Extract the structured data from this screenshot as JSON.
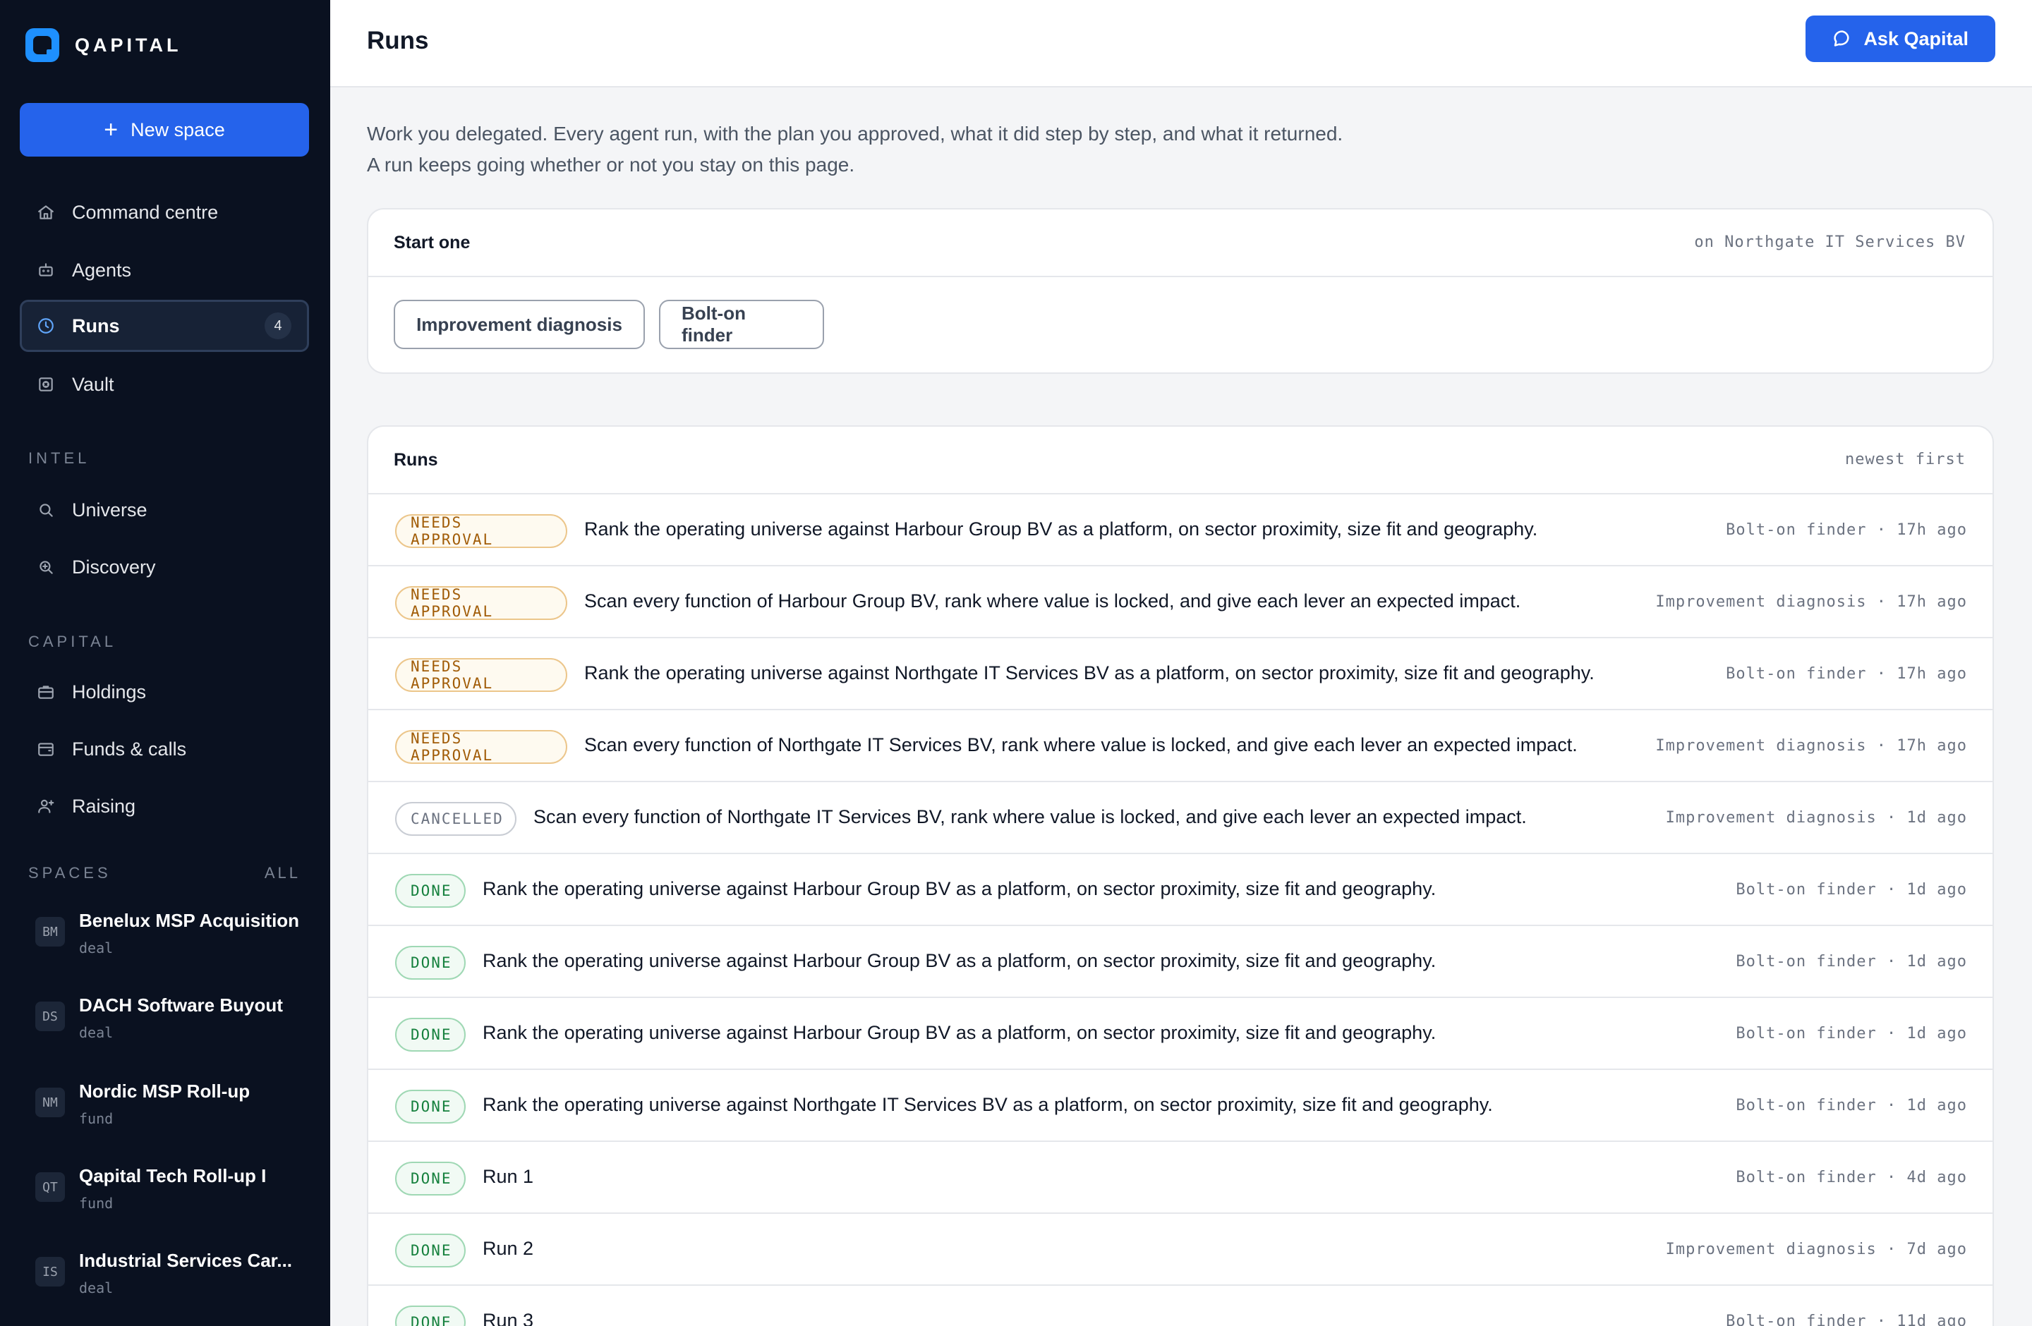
{
  "brand": {
    "name": "QAPITAL"
  },
  "sidebar": {
    "new_space_label": "New space",
    "nav": [
      {
        "label": "Command centre",
        "icon": "home-icon"
      },
      {
        "label": "Agents",
        "icon": "bot-icon"
      },
      {
        "label": "Runs",
        "icon": "clock-icon",
        "badge": "4",
        "active": true
      },
      {
        "label": "Vault",
        "icon": "vault-icon"
      }
    ],
    "intel_label": "INTEL",
    "intel": [
      {
        "label": "Universe",
        "icon": "search-icon"
      },
      {
        "label": "Discovery",
        "icon": "zoom-in-icon"
      }
    ],
    "capital_label": "CAPITAL",
    "capital": [
      {
        "label": "Holdings",
        "icon": "briefcase-icon"
      },
      {
        "label": "Funds & calls",
        "icon": "wallet-icon"
      },
      {
        "label": "Raising",
        "icon": "user-plus-icon"
      }
    ],
    "spaces_label": "SPACES",
    "spaces_all_label": "ALL",
    "spaces": [
      {
        "initials": "BM",
        "name": "Benelux MSP Acquisition",
        "kind": "deal"
      },
      {
        "initials": "DS",
        "name": "DACH Software Buyout",
        "kind": "deal"
      },
      {
        "initials": "NM",
        "name": "Nordic MSP Roll-up",
        "kind": "fund"
      },
      {
        "initials": "QT",
        "name": "Qapital Tech Roll-up I",
        "kind": "fund"
      },
      {
        "initials": "IS",
        "name": "Industrial Services Car...",
        "kind": "deal"
      }
    ]
  },
  "header": {
    "title": "Runs",
    "ask_label": "Ask Qapital"
  },
  "intro": "Work you delegated. Every agent run, with the plan you approved, what it did step by step, and what it returned. A run keeps going whether or not you stay on this page.",
  "start": {
    "title": "Start one",
    "context": "on Northgate IT Services BV",
    "buttons": [
      "Improvement diagnosis",
      "Bolt-on finder"
    ]
  },
  "runs": {
    "title": "Runs",
    "sort": "newest first",
    "items": [
      {
        "status": "NEEDS APPROVAL",
        "kind": "needs",
        "text": "Rank the operating universe against Harbour Group BV as a platform, on sector proximity, size fit and geography.",
        "meta": "Bolt-on finder · 17h ago"
      },
      {
        "status": "NEEDS APPROVAL",
        "kind": "needs",
        "text": "Scan every function of Harbour Group BV, rank where value is locked, and give each lever an expected impact.",
        "meta": "Improvement diagnosis · 17h ago"
      },
      {
        "status": "NEEDS APPROVAL",
        "kind": "needs",
        "text": "Rank the operating universe against Northgate IT Services BV as a platform, on sector proximity, size fit and geography.",
        "meta": "Bolt-on finder · 17h ago"
      },
      {
        "status": "NEEDS APPROVAL",
        "kind": "needs",
        "text": "Scan every function of Northgate IT Services BV, rank where value is locked, and give each lever an expected impact.",
        "meta": "Improvement diagnosis · 17h ago"
      },
      {
        "status": "CANCELLED",
        "kind": "cancelled",
        "text": "Scan every function of Northgate IT Services BV, rank where value is locked, and give each lever an expected impact.",
        "meta": "Improvement diagnosis · 1d ago"
      },
      {
        "status": "DONE",
        "kind": "done",
        "text": "Rank the operating universe against Harbour Group BV as a platform, on sector proximity, size fit and geography.",
        "meta": "Bolt-on finder · 1d ago"
      },
      {
        "status": "DONE",
        "kind": "done",
        "text": "Rank the operating universe against Harbour Group BV as a platform, on sector proximity, size fit and geography.",
        "meta": "Bolt-on finder · 1d ago"
      },
      {
        "status": "DONE",
        "kind": "done",
        "text": "Rank the operating universe against Harbour Group BV as a platform, on sector proximity, size fit and geography.",
        "meta": "Bolt-on finder · 1d ago"
      },
      {
        "status": "DONE",
        "kind": "done",
        "text": "Rank the operating universe against Northgate IT Services BV as a platform, on sector proximity, size fit and geography.",
        "meta": "Bolt-on finder · 1d ago"
      },
      {
        "status": "DONE",
        "kind": "done",
        "text": "Run 1",
        "meta": "Bolt-on finder · 4d ago"
      },
      {
        "status": "DONE",
        "kind": "done",
        "text": "Run 2",
        "meta": "Improvement diagnosis · 7d ago"
      },
      {
        "status": "DONE",
        "kind": "done",
        "text": "Run 3",
        "meta": "Bolt-on finder · 11d ago"
      }
    ]
  },
  "colors": {
    "accent": "#2563eb",
    "sidebar_bg": "#0a1120",
    "needs": "#a15c07",
    "done": "#15803d",
    "cancelled": "#6b7280"
  }
}
